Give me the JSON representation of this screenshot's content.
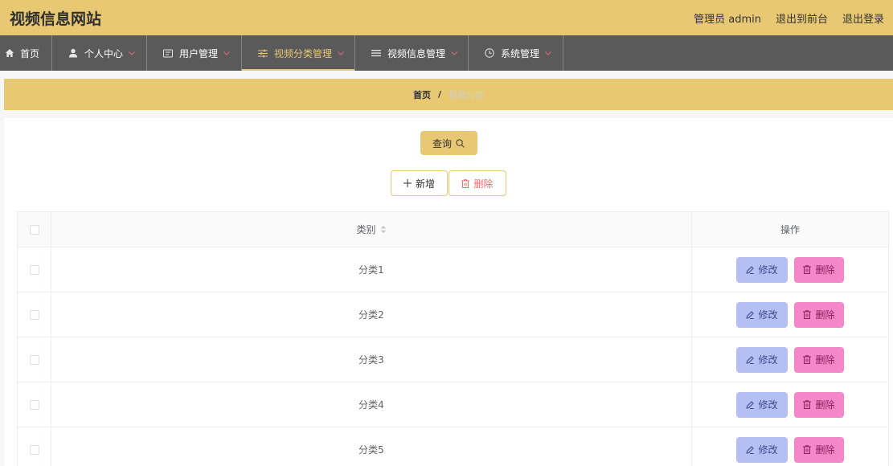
{
  "header": {
    "title": "视频信息网站",
    "admin_label": "管理员 admin",
    "back_to_front_label": "退出到前台",
    "logout_label": "退出登录"
  },
  "nav": {
    "items": [
      {
        "label": "首页",
        "icon": "home-icon"
      },
      {
        "label": "个人中心",
        "icon": "user-icon",
        "dropdown": true
      },
      {
        "label": "用户管理",
        "icon": "card-icon",
        "dropdown": true
      },
      {
        "label": "视频分类管理",
        "icon": "sliders-icon",
        "dropdown": true,
        "active": true
      },
      {
        "label": "视频信息管理",
        "icon": "list-icon",
        "dropdown": true
      },
      {
        "label": "系统管理",
        "icon": "clock-icon",
        "dropdown": true
      }
    ]
  },
  "breadcrumb": {
    "home": "首页",
    "separator": "/",
    "current": "视频分类"
  },
  "toolbar": {
    "query_label": "查询",
    "query_icon": "search-icon",
    "add_label": "新增",
    "add_icon": "plus-icon",
    "delete_label": "删除",
    "delete_icon": "trash-icon"
  },
  "table": {
    "columns": {
      "category": "类别",
      "actions": "操作"
    },
    "sort_icon": "sort-icon",
    "rows": [
      {
        "category": "分类1"
      },
      {
        "category": "分类2"
      },
      {
        "category": "分类3"
      },
      {
        "category": "分类4"
      },
      {
        "category": "分类5"
      }
    ],
    "edit_label": "修改",
    "edit_icon": "pencil-icon",
    "row_delete_label": "删除",
    "row_delete_icon": "trash-icon"
  },
  "colors": {
    "accent": "#E8C872",
    "nav_bg": "#5A5A5A",
    "nav_active": "#E8C872",
    "chevron": "#E5677F",
    "danger": "#F56C6C",
    "edit_button": "#B5BFF2",
    "delete_button": "#F387C8"
  }
}
